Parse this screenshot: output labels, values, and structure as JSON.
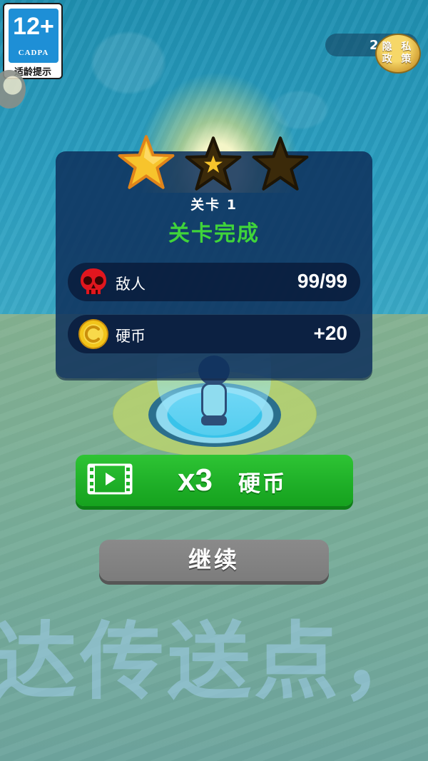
{
  "age_rating": {
    "rating": "12+",
    "org": "CADPA",
    "hint": "适龄提示"
  },
  "top_bar": {
    "counter_text": "2",
    "privacy_label_line1": "隐 私",
    "privacy_label_line2": "政 策"
  },
  "result": {
    "stars_earned": 1,
    "stars_total": 3,
    "level_label": "关卡 1",
    "status": "关卡完成",
    "enemies": {
      "label": "敌人",
      "value": "99/99",
      "icon": "skull-icon"
    },
    "coins": {
      "label": "硬币",
      "value": "+20",
      "icon": "coin-icon"
    }
  },
  "buttons": {
    "video_multiplier": "x3",
    "video_unit": "硬币",
    "video_icon": "film-icon",
    "continue_label": "继续"
  },
  "scene": {
    "background_text": "达传送点，"
  },
  "colors": {
    "status_green": "#3fd43a",
    "star_gold": "#f7c42c",
    "star_empty": "#3b2a0a",
    "button_green": "#1eae27",
    "button_gray": "#7c7c7c",
    "skull_red": "#e0161e",
    "coin_gold": "#f2c51b"
  }
}
